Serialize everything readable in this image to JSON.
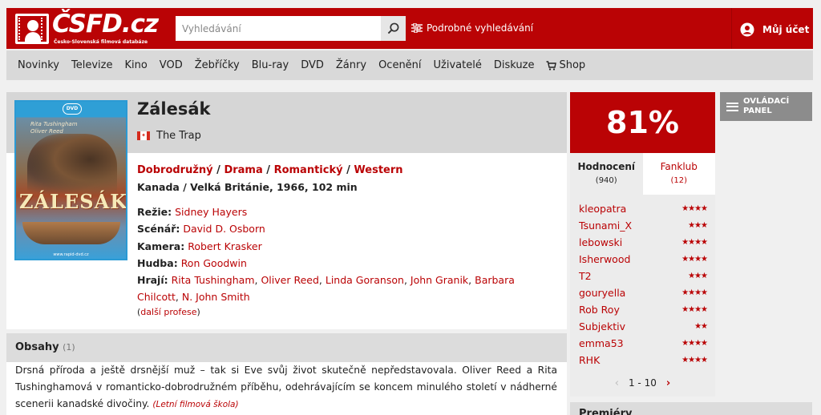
{
  "header": {
    "logo_text": "ČSFD.cz",
    "logo_subtitle": "Česko-Slovenská filmová databáze",
    "search_placeholder": "Vyhledávání",
    "advanced_search": "Podrobné vyhledávání",
    "account": "Můj účet"
  },
  "nav": {
    "items": [
      "Novinky",
      "Televize",
      "Kino",
      "VOD",
      "Žebříčky",
      "Blu-ray",
      "DVD",
      "Žánry",
      "Ocenění",
      "Uživatelé",
      "Diskuze",
      "Shop"
    ]
  },
  "film": {
    "title": "Zálesák",
    "original_title": "The Trap",
    "genres": [
      "Dobrodružný",
      "Drama",
      "Romantický",
      "Western"
    ],
    "origin": "Kanada / Velká Británie, 1966, 102 min",
    "credits": {
      "directing_label": "Režie:",
      "directing": "Sidney Hayers",
      "screenplay_label": "Scénář:",
      "screenplay": "David D. Osborn",
      "camera_label": "Kamera:",
      "camera": "Robert Krasker",
      "music_label": "Hudba:",
      "music": "Ron Goodwin",
      "cast_label": "Hrají:",
      "cast": [
        "Rita Tushingham",
        "Oliver Reed",
        "Linda Goranson",
        "John Granik",
        "Barbara Chilcott",
        "N. John Smith"
      ]
    },
    "more_professions": "další profese",
    "poster": {
      "brand": "DVD",
      "names": "Rita Tushingham\nOliver Reed",
      "title": "ZÁLESÁK",
      "url": "www.rapid-dvd.cz"
    }
  },
  "synopsis": {
    "title": "Obsahy",
    "count": "(1)",
    "text": "Drsná příroda a ještě drsnější muž – tak si Eve svůj život skutečně nepředstavovala. Oliver Reed a Rita Tushinghamová v romanticko-dobrodružném příběhu, odehrávajícím se koncem minulého století v nádherné scenerii kanadské divočiny.",
    "source": "(Letní filmová škola)"
  },
  "rating": {
    "percent": "81%",
    "tabs": [
      {
        "label": "Hodnocení",
        "count": "(940)"
      },
      {
        "label": "Fanklub",
        "count": "(12)"
      }
    ],
    "users": [
      {
        "name": "kleopatra",
        "stars": "★★★★"
      },
      {
        "name": "Tsunami_X",
        "stars": "★★★"
      },
      {
        "name": "lebowski",
        "stars": "★★★★"
      },
      {
        "name": "Isherwood",
        "stars": "★★★★"
      },
      {
        "name": "T2",
        "stars": "★★★"
      },
      {
        "name": "gouryella",
        "stars": "★★★★"
      },
      {
        "name": "Rob Roy",
        "stars": "★★★★"
      },
      {
        "name": "Subjektiv",
        "stars": "★★"
      },
      {
        "name": "emma53",
        "stars": "★★★★"
      },
      {
        "name": "RHK",
        "stars": "★★★★"
      }
    ],
    "pager": "1 - 10"
  },
  "control_panel": {
    "line1": "OVLÁDACÍ",
    "line2": "PANEL"
  },
  "premiery": "Premiéry",
  "colors": {
    "brand_red": "#ba0305",
    "nav_bg": "#d9d9d9",
    "panel_gray": "#8c8c8c"
  }
}
